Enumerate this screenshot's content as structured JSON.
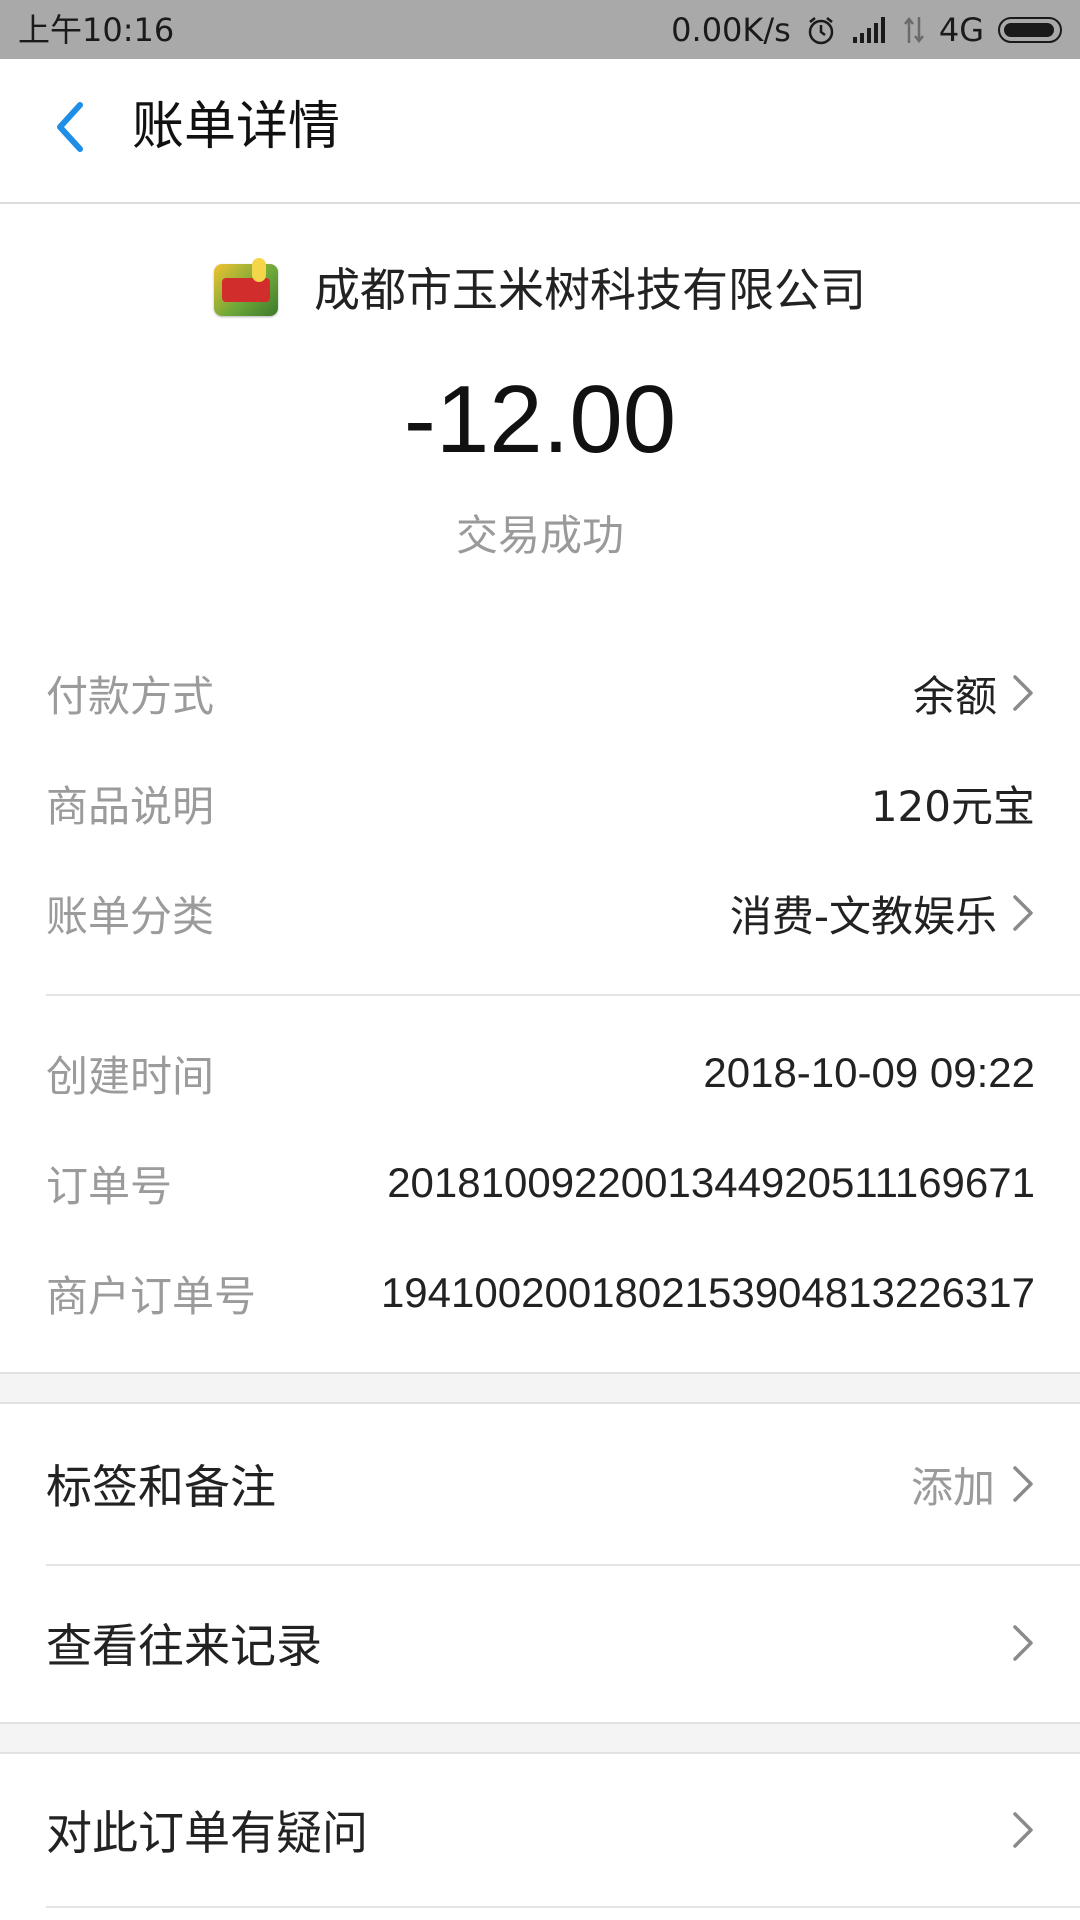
{
  "status_bar": {
    "time": "上午10:16",
    "net_speed": "0.00K/s",
    "network": "4G"
  },
  "nav": {
    "title": "账单详情"
  },
  "merchant": {
    "name": "成都市玉米树科技有限公司"
  },
  "amount": "-12.00",
  "transaction_status": "交易成功",
  "details_primary": [
    {
      "label": "付款方式",
      "value": "余额",
      "has_arrow": true
    },
    {
      "label": "商品说明",
      "value": "120元宝",
      "has_arrow": false
    },
    {
      "label": "账单分类",
      "value": "消费-文教娱乐",
      "has_arrow": true
    }
  ],
  "details_secondary": [
    {
      "label": "创建时间",
      "value": "2018-10-09 09:22"
    },
    {
      "label": "订单号",
      "value": "2018100922001344920511169671"
    },
    {
      "label": "商户订单号",
      "value": "1941002001802153904813226317"
    }
  ],
  "actions": {
    "tags": {
      "label": "标签和备注",
      "hint": "添加"
    },
    "history": {
      "label": "查看往来记录"
    },
    "question": {
      "label": "对此订单有疑问"
    }
  },
  "colors": {
    "accent": "#1e8ee6",
    "status_bar_bg": "#a9a9a9",
    "label_gray": "#9b9b9b",
    "section_bg": "#f4f4f4"
  }
}
